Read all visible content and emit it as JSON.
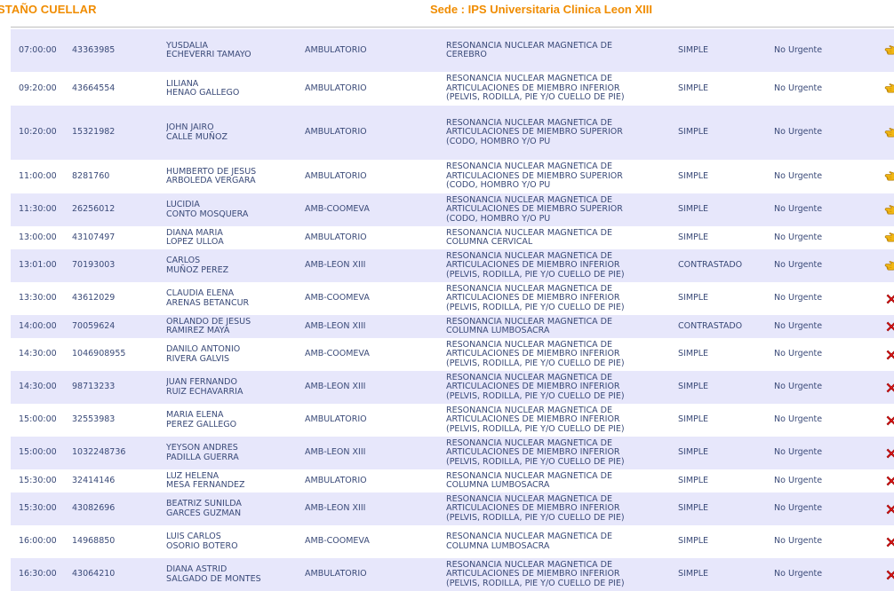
{
  "header": {
    "doctor_name": "STAÑO CUELLAR",
    "sede": "Sede : IPS Universitaria Clinica Leon XIII"
  },
  "colors": {
    "accent": "#f08c00",
    "row_alt": "#e7e7fb",
    "text": "#3a4a78",
    "cancel": "#e01818"
  },
  "rows": [
    {
      "time": "07:00:00",
      "id": "43363985",
      "name1": "YUSDALIA",
      "name2": "ECHEVERRI TAMAYO",
      "service": "AMBULATORIO",
      "proc": [
        "RESONANCIA NUCLEAR MAGNETICA DE",
        "CEREBRO"
      ],
      "type": "SIMPLE",
      "priority": "No Urgente",
      "icon": "hand-pointer-icon",
      "h": 48
    },
    {
      "time": "09:20:00",
      "id": "43664554",
      "name1": "LILIANA",
      "name2": "HENAO GALLEGO",
      "service": "AMBULATORIO",
      "proc": [
        "RESONANCIA NUCLEAR MAGNETICA DE",
        "ARTICULACIONES DE MIEMBRO INFERIOR",
        "(PELVIS, RODILLA, PIE Y/O CUELLO DE PIE)"
      ],
      "type": "SIMPLE",
      "priority": "No Urgente",
      "icon": "hand-pointer-icon",
      "h": 38
    },
    {
      "time": "10:20:00",
      "id": "15321982",
      "name1": "JOHN JAIRO",
      "name2": "CALLE MUÑOZ",
      "service": "AMBULATORIO",
      "proc": [
        "RESONANCIA NUCLEAR MAGNETICA DE",
        "ARTICULACIONES DE MIEMBRO SUPERIOR",
        "(CODO, HOMBRO Y/O PU"
      ],
      "type": "SIMPLE",
      "priority": "No Urgente",
      "icon": "hand-pointer-icon",
      "h": 61
    },
    {
      "time": "11:00:00",
      "id": "8281760",
      "name1": "HUMBERTO DE JESUS",
      "name2": "ARBOLEDA VERGARA",
      "service": "AMBULATORIO",
      "proc": [
        "RESONANCIA NUCLEAR MAGNETICA DE",
        "ARTICULACIONES DE MIEMBRO SUPERIOR",
        "(CODO, HOMBRO Y/O PU"
      ],
      "type": "SIMPLE",
      "priority": "No Urgente",
      "icon": "hand-pointer-icon",
      "h": 38
    },
    {
      "time": "11:30:00",
      "id": "26256012",
      "name1": "LUCIDIA",
      "name2": "CONTO MOSQUERA",
      "service": "AMB-COOMEVA",
      "proc": [
        "RESONANCIA NUCLEAR MAGNETICA DE",
        "ARTICULACIONES DE MIEMBRO SUPERIOR",
        "(CODO, HOMBRO Y/O PU"
      ],
      "type": "SIMPLE",
      "priority": "No Urgente",
      "icon": "hand-pointer-icon",
      "h": 37
    },
    {
      "time": "13:00:00",
      "id": "43107497",
      "name1": "DIANA MARIA",
      "name2": "LOPEZ ULLOA",
      "service": "AMBULATORIO",
      "proc": [
        "RESONANCIA NUCLEAR MAGNETICA DE",
        "COLUMNA CERVICAL"
      ],
      "type": "SIMPLE",
      "priority": "No Urgente",
      "icon": "hand-pointer-icon",
      "h": 26
    },
    {
      "time": "13:01:00",
      "id": "70193003",
      "name1": "CARLOS",
      "name2": "MUÑOZ PEREZ",
      "service": "AMB-LEON XIII",
      "proc": [
        "RESONANCIA NUCLEAR MAGNETICA DE",
        "ARTICULACIONES DE MIEMBRO INFERIOR",
        "(PELVIS, RODILLA, PIE Y/O CUELLO DE PIE)"
      ],
      "type": "CONTRASTADO",
      "priority": "No Urgente",
      "icon": "hand-pointer-icon",
      "h": 37
    },
    {
      "time": "13:30:00",
      "id": "43612029",
      "name1": "CLAUDIA ELENA",
      "name2": "ARENAS BETANCUR",
      "service": "AMB-COOMEVA",
      "proc": [
        "RESONANCIA NUCLEAR MAGNETICA DE",
        "ARTICULACIONES DE MIEMBRO INFERIOR",
        "(PELVIS, RODILLA, PIE Y/O CUELLO DE PIE)"
      ],
      "type": "SIMPLE",
      "priority": "No Urgente",
      "icon": "cancel-x-icon",
      "h": 37
    },
    {
      "time": "14:00:00",
      "id": "70059624",
      "name1": "ORLANDO DE JESUS",
      "name2": "RAMIREZ MAYA",
      "service": "AMB-LEON XIII",
      "proc": [
        "RESONANCIA NUCLEAR MAGNETICA DE",
        "COLUMNA LUMBOSACRA"
      ],
      "type": "CONTRASTADO",
      "priority": "No Urgente",
      "icon": "cancel-x-icon",
      "h": 26
    },
    {
      "time": "14:30:00",
      "id": "1046908955",
      "name1": "DANILO ANTONIO",
      "name2": "RIVERA GALVIS",
      "service": "AMB-COOMEVA",
      "proc": [
        "RESONANCIA NUCLEAR MAGNETICA DE",
        "ARTICULACIONES DE MIEMBRO INFERIOR",
        "(PELVIS, RODILLA, PIE Y/O CUELLO DE PIE)"
      ],
      "type": "SIMPLE",
      "priority": "No Urgente",
      "icon": "cancel-x-icon",
      "h": 37
    },
    {
      "time": "14:30:00",
      "id": "98713233",
      "name1": "JUAN FERNANDO",
      "name2": "RUIZ ECHAVARRIA",
      "service": "AMB-LEON XIII",
      "proc": [
        "RESONANCIA NUCLEAR MAGNETICA DE",
        "ARTICULACIONES DE MIEMBRO INFERIOR",
        "(PELVIS, RODILLA, PIE Y/O CUELLO DE PIE)"
      ],
      "type": "SIMPLE",
      "priority": "No Urgente",
      "icon": "cancel-x-icon",
      "h": 37
    },
    {
      "time": "15:00:00",
      "id": "32553983",
      "name1": "MARIA ELENA",
      "name2": "PEREZ GALLEGO",
      "service": "AMBULATORIO",
      "proc": [
        "RESONANCIA NUCLEAR MAGNETICA DE",
        "ARTICULACIONES DE MIEMBRO INFERIOR",
        "(PELVIS, RODILLA, PIE Y/O CUELLO DE PIE)"
      ],
      "type": "SIMPLE",
      "priority": "No Urgente",
      "icon": "cancel-x-icon",
      "h": 37
    },
    {
      "time": "15:00:00",
      "id": "1032248736",
      "name1": "YEYSON ANDRES",
      "name2": "PADILLA GUERRA",
      "service": "AMB-LEON XIII",
      "proc": [
        "RESONANCIA NUCLEAR MAGNETICA DE",
        "ARTICULACIONES DE MIEMBRO INFERIOR",
        "(PELVIS, RODILLA, PIE Y/O CUELLO DE PIE)"
      ],
      "type": "SIMPLE",
      "priority": "No Urgente",
      "icon": "cancel-x-icon",
      "h": 37
    },
    {
      "time": "15:30:00",
      "id": "32414146",
      "name1": "LUZ HELENA",
      "name2": "MESA FERNANDEZ",
      "service": "AMBULATORIO",
      "proc": [
        "RESONANCIA NUCLEAR MAGNETICA DE",
        "COLUMNA LUMBOSACRA"
      ],
      "type": "SIMPLE",
      "priority": "No Urgente",
      "icon": "cancel-x-icon",
      "h": 26
    },
    {
      "time": "15:30:00",
      "id": "43082696",
      "name1": "BEATRIZ SUNILDA",
      "name2": "GARCES GUZMAN",
      "service": "AMB-LEON XIII",
      "proc": [
        "RESONANCIA NUCLEAR MAGNETICA DE",
        "ARTICULACIONES DE MIEMBRO INFERIOR",
        "(PELVIS, RODILLA, PIE Y/O CUELLO DE PIE)"
      ],
      "type": "SIMPLE",
      "priority": "No Urgente",
      "icon": "cancel-x-icon",
      "h": 37
    },
    {
      "time": "16:00:00",
      "id": "14968850",
      "name1": "LUIS CARLOS",
      "name2": "OSORIO BOTERO",
      "service": "AMB-COOMEVA",
      "proc": [
        "RESONANCIA NUCLEAR MAGNETICA DE",
        "COLUMNA LUMBOSACRA"
      ],
      "type": "SIMPLE",
      "priority": "No Urgente",
      "icon": "cancel-x-icon",
      "h": 37
    },
    {
      "time": "16:30:00",
      "id": "43064210",
      "name1": "DIANA ASTRID",
      "name2": "SALGADO DE MONTES",
      "service": "AMBULATORIO",
      "proc": [
        "RESONANCIA NUCLEAR MAGNETICA DE",
        "ARTICULACIONES DE MIEMBRO INFERIOR",
        "(PELVIS, RODILLA, PIE Y/O CUELLO DE PIE)"
      ],
      "type": "SIMPLE",
      "priority": "No Urgente",
      "icon": "cancel-x-icon",
      "h": 37
    }
  ]
}
